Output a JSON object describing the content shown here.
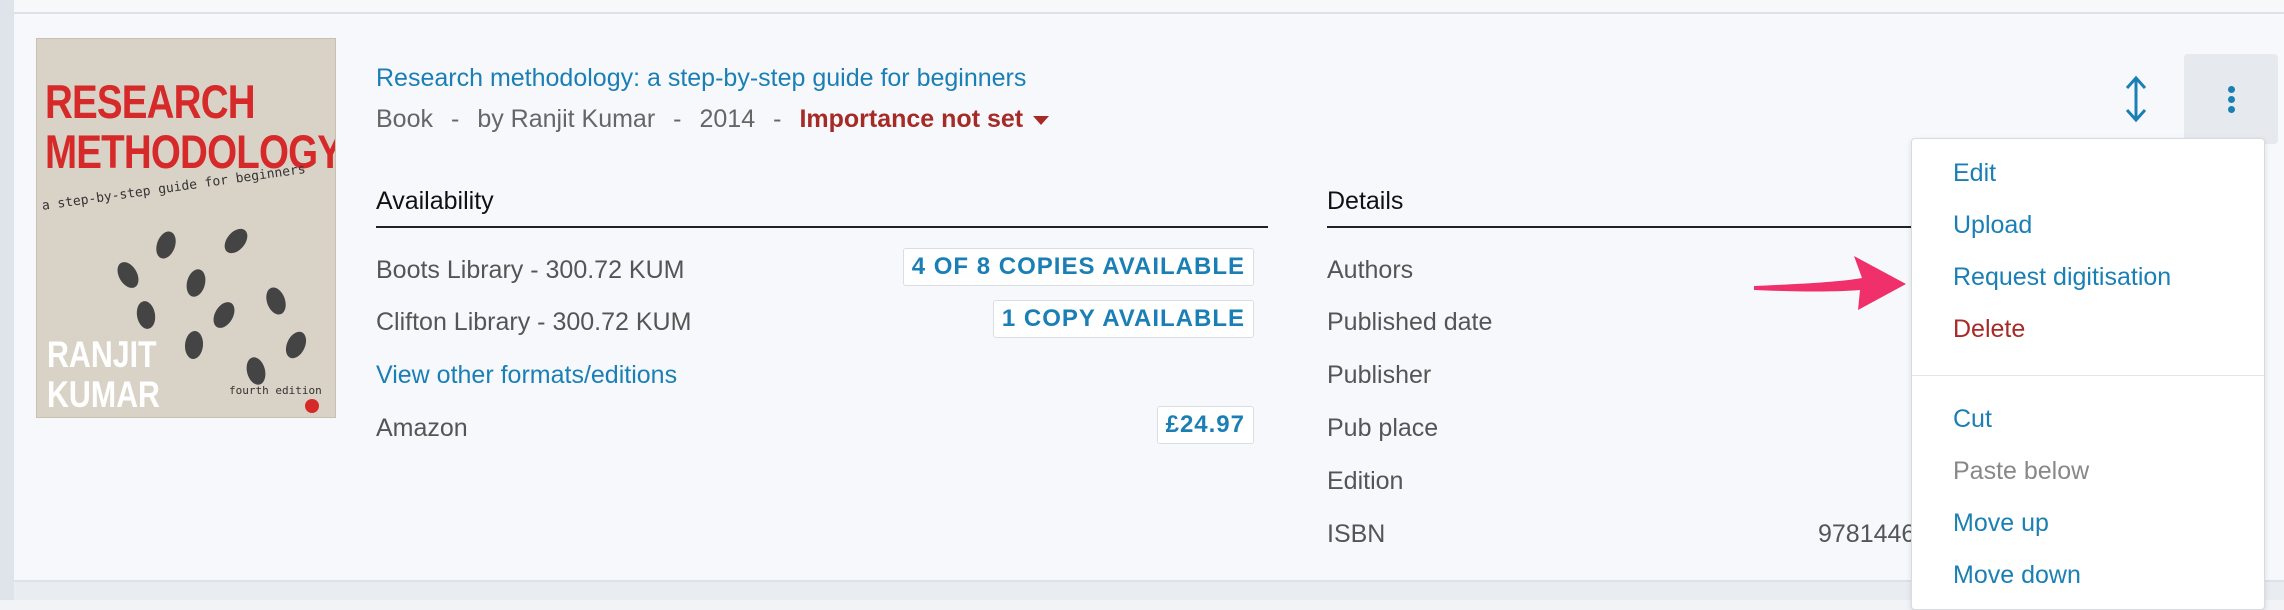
{
  "book": {
    "title": "Research methodology: a step-by-step guide for beginners",
    "type": "Book",
    "separator": "-",
    "author_text": "by Ranjit Kumar",
    "year": "2014",
    "importance": "Importance not set"
  },
  "cover": {
    "title_line1": "RESEARCH",
    "title_line2": "METHODOLOGY",
    "subtitle": "a step-by-step guide for beginners",
    "author_line1": "RANJIT",
    "author_line2": "KUMAR",
    "edition": "fourth edition",
    "accent_color": "#d62a2a"
  },
  "availability": {
    "heading": "Availability",
    "rows": [
      {
        "location": "Boots Library - 300.72 KUM",
        "status": "4 OF 8 COPIES AVAILABLE"
      },
      {
        "location": "Clifton Library - 300.72 KUM",
        "status": "1 COPY AVAILABLE"
      }
    ],
    "other_formats_link": "View other formats/editions",
    "vendor": {
      "name": "Amazon",
      "price": "£24.97"
    }
  },
  "details": {
    "heading": "Details",
    "labels": [
      "Authors",
      "Published date",
      "Publisher",
      "Pub place",
      "Edition",
      "ISBN"
    ],
    "isbn_partial": "9781446"
  },
  "actions": {
    "reorder_icon": "up-down-arrows-icon",
    "more_icon": "vertical-ellipsis-icon"
  },
  "menu": {
    "items_top": [
      "Edit",
      "Upload",
      "Request digitisation",
      "Delete"
    ],
    "items_bottom": [
      "Cut",
      "Paste below",
      "Move up",
      "Move down"
    ]
  },
  "colors": {
    "link": "#1a7fb5",
    "danger": "#a62a26",
    "annotation_arrow": "#f0306a"
  }
}
